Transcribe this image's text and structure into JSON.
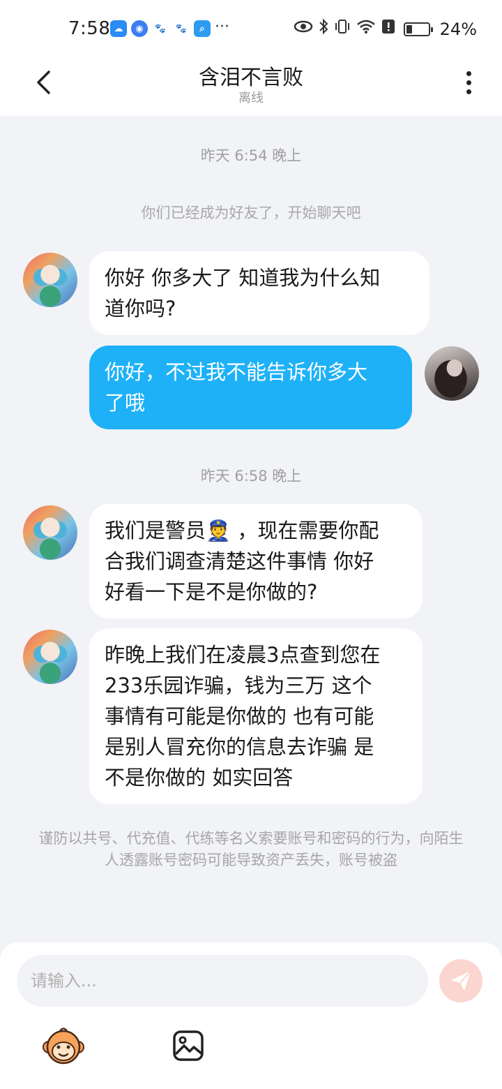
{
  "status_bar": {
    "time": "7:58",
    "apps": [
      {
        "name": "weather-app-icon",
        "color": "#2a8cf5"
      },
      {
        "name": "browser-app-icon",
        "color": "#3a7ef0"
      },
      {
        "name": "baidu-app-icon",
        "color": "#3b6df2"
      },
      {
        "name": "baidu-app-icon",
        "color": "#3b6df2"
      },
      {
        "name": "search-app-icon",
        "color": "#2d9bf0"
      }
    ],
    "more": "···",
    "battery_level": 0.24,
    "battery_text": "24%"
  },
  "header": {
    "title": "含泪不言败",
    "subtitle": "离线"
  },
  "chat": {
    "timestamp_1": "昨天 6:54 晚上",
    "system_note": "你们已经成为好友了，开始聊天吧",
    "msg_1": "你好  你多大了 知道我为什么知\n道你吗?",
    "msg_2": "你好，不过我不能告诉你多大\n了哦",
    "timestamp_2": "昨天 6:58 晚上",
    "msg_3": "我们是警员👮 ，现在需要你配\n合我们调查清楚这件事情 你好\n好看一下是不是你做的?",
    "msg_4": "昨晚上我们在凌晨3点查到您在\n233乐园诈骗，钱为三万 这个\n事情有可能是你做的 也有可能\n是别人冒充你的信息去诈骗 是\n不是你做的 如实回答"
  },
  "disclaimer": "谨防以共号、代充值、代练等名义索要账号和密码的行为，向陌生人透露账号密码可能导致资产丢失，账号被盗",
  "input": {
    "placeholder": "请输入...",
    "value": ""
  },
  "colors": {
    "accent": "#1eb1f8",
    "background": "#f2f3f7",
    "send_disabled": "#fbd6d0"
  }
}
